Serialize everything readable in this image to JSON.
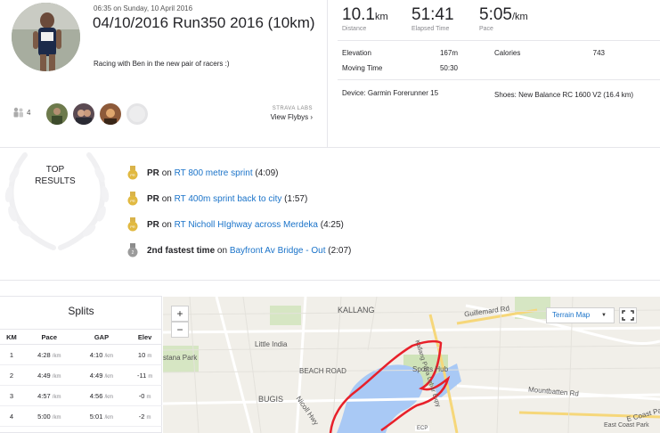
{
  "activity": {
    "datetime": "06:35 on Sunday, 10 April 2016",
    "title": "04/10/2016 Run350 2016 (10km)",
    "description": "Racing with Ben in the new pair of racers :)",
    "kudos_count": "4"
  },
  "flybys": {
    "label": "STRAVA LABS",
    "link": "View Flybys"
  },
  "stats": {
    "distance": {
      "value": "10.1",
      "unit": "km",
      "label": "Distance"
    },
    "elapsed": {
      "value": "51:41",
      "unit": "",
      "label": "Elapsed Time"
    },
    "pace": {
      "value": "5:05",
      "unit": "/km",
      "label": "Pace"
    },
    "elevation_label": "Elevation",
    "elevation_value": "167m",
    "calories_label": "Calories",
    "calories_value": "743",
    "moving_label": "Moving Time",
    "moving_value": "50:30",
    "device": "Device: Garmin Forerunner 15",
    "shoes": "Shoes: New Balance RC 1600 V2 (16.4 km)"
  },
  "top_results": {
    "label_line1": "TOP",
    "label_line2": "RESULTS",
    "items": [
      {
        "prefix": "PR",
        "on": "on",
        "segment": "RT 800 metre sprint",
        "time": "(4:09)",
        "medal": "gold"
      },
      {
        "prefix": "PR",
        "on": "on",
        "segment": "RT 400m sprint back to city",
        "time": "(1:57)",
        "medal": "gold"
      },
      {
        "prefix": "PR",
        "on": "on",
        "segment": "RT Nicholl HIghway across Merdeka",
        "time": "(4:25)",
        "medal": "gold"
      },
      {
        "prefix": "2nd fastest time",
        "on": "on",
        "segment": "Bayfront Av Bridge - Out",
        "time": "(2:07)",
        "medal": "silver"
      }
    ]
  },
  "splits": {
    "title": "Splits",
    "headers": [
      "KM",
      "Pace",
      "GAP",
      "Elev"
    ],
    "rows": [
      {
        "km": "1",
        "pace": "4:28",
        "gap": "4:10",
        "elev": "10",
        "pace_unit": "/km",
        "elev_unit": "m"
      },
      {
        "km": "2",
        "pace": "4:49",
        "gap": "4:49",
        "elev": "-11",
        "pace_unit": "/km",
        "elev_unit": "m"
      },
      {
        "km": "3",
        "pace": "4:57",
        "gap": "4:56",
        "elev": "-0",
        "pace_unit": "/km",
        "elev_unit": "m"
      },
      {
        "km": "4",
        "pace": "5:00",
        "gap": "5:01",
        "elev": "-2",
        "pace_unit": "/km",
        "elev_unit": "m"
      }
    ]
  },
  "map": {
    "zoom_in": "+",
    "zoom_out": "−",
    "terrain_label": "Terrain Map",
    "labels": {
      "kallang": "KALLANG",
      "guillemard": "Guillemard Rd",
      "little_india": "Little India",
      "stana_park": "stana Park",
      "beach_road": "BEACH ROAD",
      "bugis": "BUGIS",
      "sports_hub": "Sports Hub",
      "kallang_paya": "Kallang Paya Lebar Expy",
      "mountbatten": "Mountbatten Rd",
      "nicoll": "Nicoll Hwy",
      "e_coast": "E Coast Pa",
      "east_coast_park": "East Coast Park",
      "ecp": "ECP"
    },
    "colors": {
      "route": "#e8202a",
      "water": "#a9c9f5",
      "park": "#cfe3b8"
    }
  }
}
